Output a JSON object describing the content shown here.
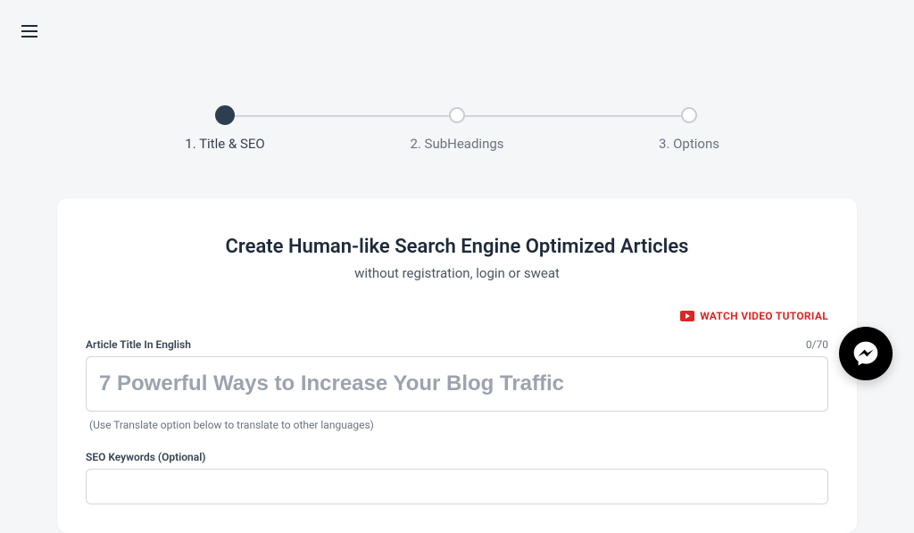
{
  "stepper": {
    "steps": [
      {
        "label": "1. Title & SEO",
        "active": true
      },
      {
        "label": "2. SubHeadings",
        "active": false
      },
      {
        "label": "3. Options",
        "active": false
      }
    ]
  },
  "card": {
    "heading": "Create Human-like Search Engine Optimized Articles",
    "subheading": "without registration, login or sweat",
    "watch_tutorial": "WATCH VIDEO TUTORIAL",
    "title_field": {
      "label": "Article Title In English",
      "counter": "0/70",
      "placeholder": "7 Powerful Ways to Increase Your Blog Traffic",
      "helper": "(Use Translate option below to translate to other languages)"
    },
    "keywords_field": {
      "label": "SEO Keywords (Optional)"
    }
  }
}
